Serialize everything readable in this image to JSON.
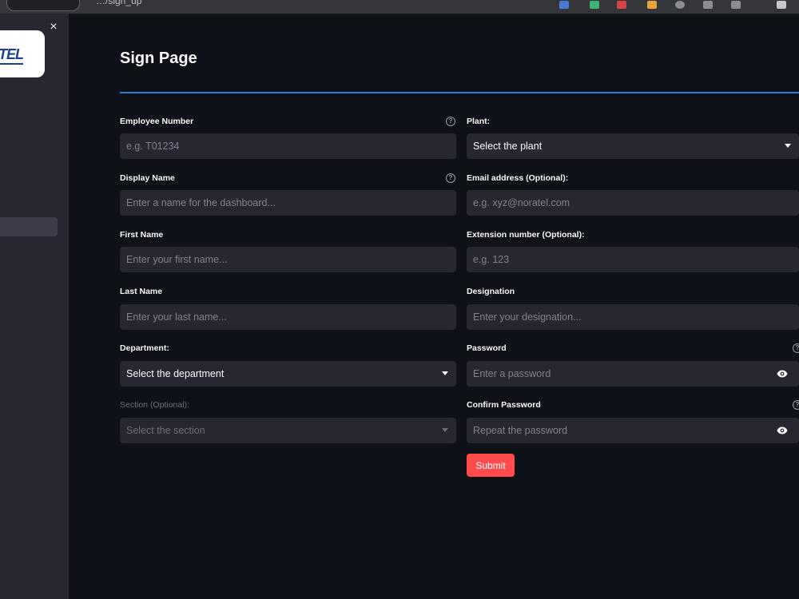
{
  "page": {
    "title": "Sign Page"
  },
  "sidebar": {
    "logo_text": "TEL",
    "close_glyph": "×"
  },
  "browser": {
    "url_fragment": "…/sign_up"
  },
  "fields": {
    "employee_number": {
      "label": "Employee Number",
      "placeholder": "e.g. T01234"
    },
    "display_name": {
      "label": "Display Name",
      "placeholder": "Enter a name for the dashboard..."
    },
    "first_name": {
      "label": "First Name",
      "placeholder": "Enter your first name..."
    },
    "last_name": {
      "label": "Last Name",
      "placeholder": "Enter your last name..."
    },
    "department": {
      "label": "Department:",
      "selected": "Select the department"
    },
    "section": {
      "label": "Section (Optional):",
      "selected": "Select the section"
    },
    "plant": {
      "label": "Plant:",
      "selected": "Select the plant"
    },
    "email": {
      "label": "Email address (Optional):",
      "placeholder": "e.g. xyz@noratel.com"
    },
    "extension": {
      "label": "Extension number (Optional):",
      "placeholder": "e.g. 123"
    },
    "designation": {
      "label": "Designation",
      "placeholder": "Enter your designation..."
    },
    "password": {
      "label": "Password",
      "placeholder": "Enter a password"
    },
    "confirm_password": {
      "label": "Confirm Password",
      "placeholder": "Repeat the password"
    }
  },
  "submit": {
    "label": "Submit"
  },
  "icons": {
    "help": "help-circle-icon",
    "visibility": "eye-icon",
    "dropdown": "chevron-down-icon"
  },
  "colors": {
    "accent_rule": "#2a7fd4",
    "submit_bg": "#ff4b4b",
    "sidebar_bg": "#262730",
    "page_bg": "#0e1117"
  }
}
